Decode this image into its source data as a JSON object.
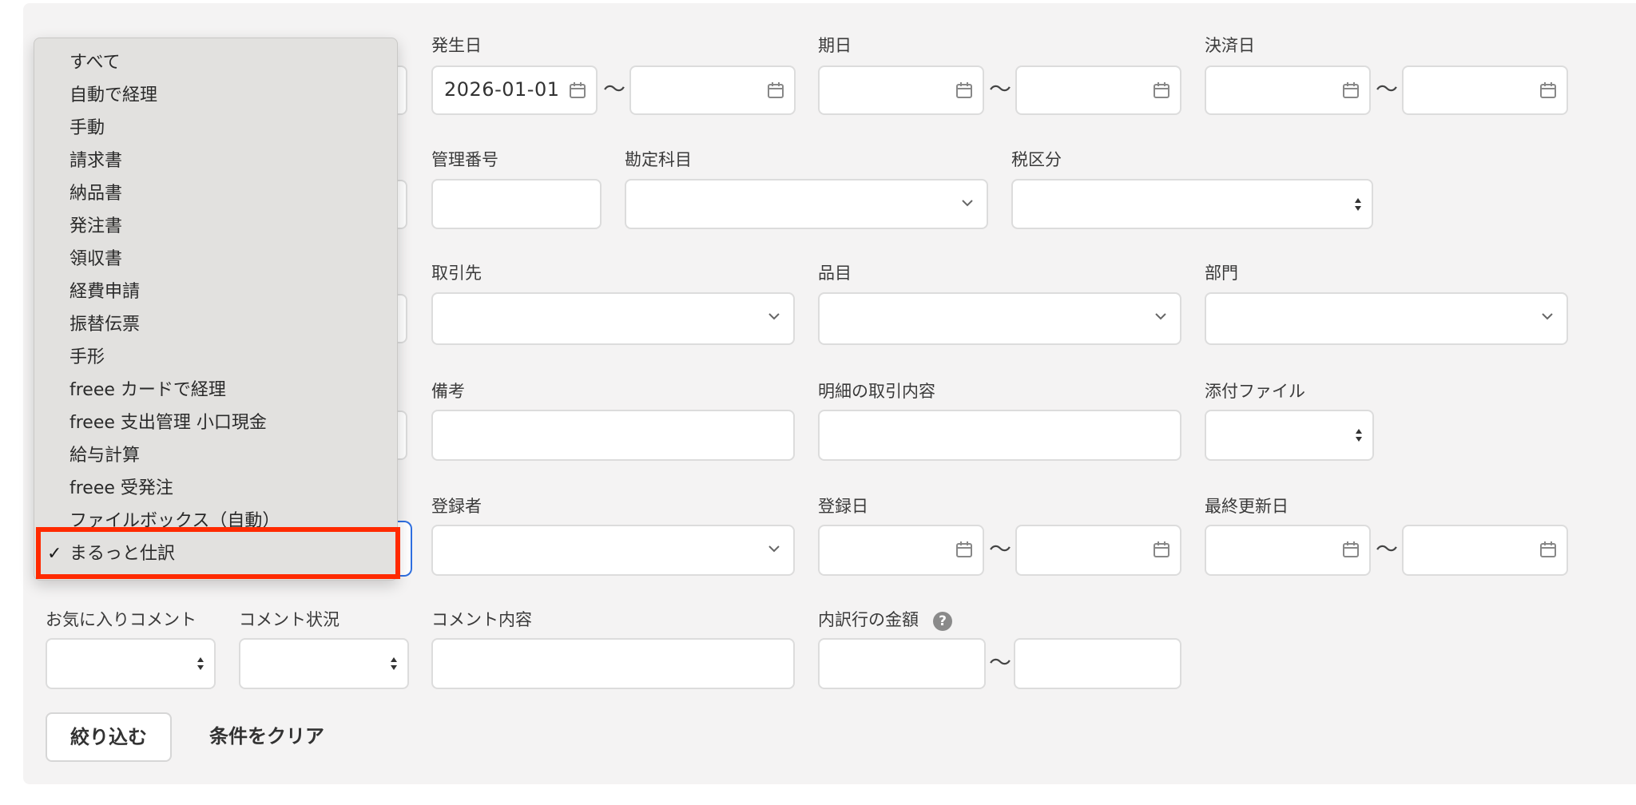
{
  "fields": {
    "hassei_label": "発生日",
    "hassei_from": "2026-01-01",
    "kijitsu_label": "期日",
    "kessai_label": "決済日",
    "kanri_label": "管理番号",
    "kanjou_label": "勘定科目",
    "zei_label": "税区分",
    "torihiki_label": "取引先",
    "hinmoku_label": "品目",
    "bumon_label": "部門",
    "biko_label": "備考",
    "meisai_label": "明細の取引内容",
    "tenpu_label": "添付ファイル",
    "tourokusha_label": "登録者",
    "tourokubi_label": "登録日",
    "koushin_label": "最終更新日",
    "okiniiri_label": "お気に入りコメント",
    "comment_status_label": "コメント状況",
    "comment_body_label": "コメント内容",
    "uchiwake_label": "内訳行の金額",
    "help_glyph": "?"
  },
  "tilde": "〜",
  "buttons": {
    "filter": "絞り込む",
    "clear": "条件をクリア"
  },
  "dropdown": {
    "check": "✓",
    "options": [
      "すべて",
      "自動で経理",
      "手動",
      "請求書",
      "納品書",
      "発注書",
      "領収書",
      "経費申請",
      "振替伝票",
      "手形",
      "freee カードで経理",
      "freee 支出管理 小口現金",
      "給与計算",
      "freee 受発注",
      "ファイルボックス（自動）",
      "まるっと仕訳"
    ],
    "selected_index": 15
  },
  "colors": {
    "highlight": "#ff2a00",
    "focus": "#2f6fe0"
  }
}
